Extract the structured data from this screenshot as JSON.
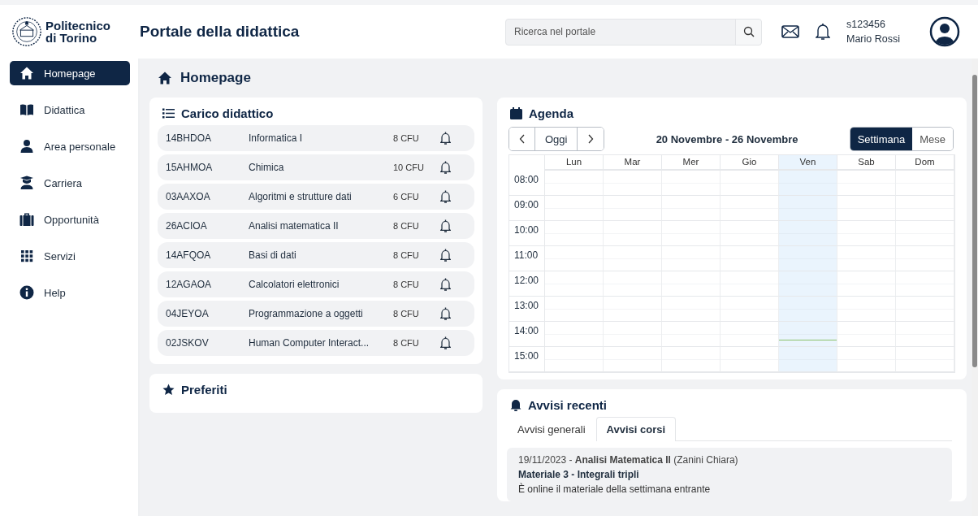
{
  "header": {
    "logo_line1": "Politecnico",
    "logo_line2": "di Torino",
    "title": "Portale della didattica",
    "search": {
      "placeholder": "Ricerca nel portale"
    },
    "user_id": "s123456",
    "user_name": "Mario Rossi"
  },
  "sidebar": {
    "items": [
      {
        "label": "Homepage",
        "kind": "home",
        "selected": true
      },
      {
        "label": "Didattica",
        "kind": "book",
        "selected": false
      },
      {
        "label": "Area personale",
        "kind": "person",
        "selected": false
      },
      {
        "label": "Carriera",
        "kind": "graduate",
        "selected": false
      },
      {
        "label": "Opportunità",
        "kind": "briefcase",
        "selected": false
      },
      {
        "label": "Servizi",
        "kind": "grid",
        "selected": false
      },
      {
        "label": "Help",
        "kind": "info",
        "selected": false
      }
    ]
  },
  "page_title": "Homepage",
  "carico": {
    "title": "Carico didattico",
    "rows": [
      {
        "code": "14BHDOA",
        "name": "Informatica I",
        "cfu": "8 CFU"
      },
      {
        "code": "15AHMOA",
        "name": "Chimica",
        "cfu": "10 CFU"
      },
      {
        "code": "03AAXOA",
        "name": "Algoritmi e strutture dati",
        "cfu": "6 CFU"
      },
      {
        "code": "26ACIOA",
        "name": "Analisi matematica II",
        "cfu": "8 CFU"
      },
      {
        "code": "14AFQOA",
        "name": "Basi di dati",
        "cfu": "8 CFU"
      },
      {
        "code": "12AGAOA",
        "name": "Calcolatori elettronici",
        "cfu": "8 CFU"
      },
      {
        "code": "04JEYOA",
        "name": "Programmazione a oggetti",
        "cfu": "8 CFU"
      },
      {
        "code": "02JSKOV",
        "name": "Human Computer Interact...",
        "cfu": "8 CFU"
      }
    ]
  },
  "preferiti": {
    "title": "Preferiti"
  },
  "agenda": {
    "title": "Agenda",
    "today_button": "Oggi",
    "range": "20 Novembre - 26 Novembre",
    "views": [
      {
        "label": "Settimana",
        "selected": true
      },
      {
        "label": "Mese",
        "selected": false
      }
    ],
    "days": [
      {
        "label": "Lun",
        "today": false
      },
      {
        "label": "Mar",
        "today": false
      },
      {
        "label": "Mer",
        "today": false
      },
      {
        "label": "Gio",
        "today": false
      },
      {
        "label": "Ven",
        "today": true
      },
      {
        "label": "Sab",
        "today": false
      },
      {
        "label": "Dom",
        "today": false
      }
    ],
    "hours": [
      {
        "label": "08:00",
        "now": false
      },
      {
        "label": "09:00",
        "now": false
      },
      {
        "label": "10:00",
        "now": false
      },
      {
        "label": "11:00",
        "now": false
      },
      {
        "label": "12:00",
        "now": false
      },
      {
        "label": "13:00",
        "now": false
      },
      {
        "label": "14:00",
        "now": true
      },
      {
        "label": "15:00",
        "now": false
      }
    ]
  },
  "avvisi": {
    "title": "Avvisi recenti",
    "tabs": [
      {
        "label": "Avvisi generali",
        "selected": false
      },
      {
        "label": "Avvisi corsi",
        "selected": true
      }
    ],
    "items": [
      {
        "line": "19/11/2023 - **Analisi Matematica II** (Zanini Chiara)",
        "subject": "Materiale 3 - Integrali tripli",
        "body": "È online il materiale della settimana entrante"
      }
    ]
  }
}
